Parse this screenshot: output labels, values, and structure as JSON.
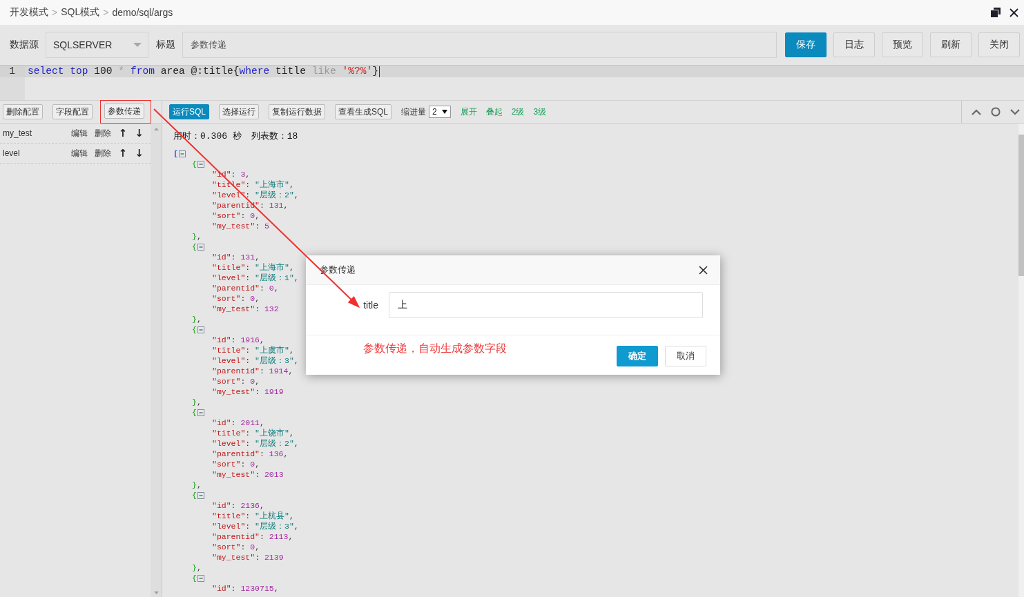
{
  "breadcrumb": [
    {
      "label": "开发模式",
      "separator": ">"
    },
    {
      "label": "SQL模式",
      "separator": ">"
    },
    {
      "label": "demo/sql/args"
    }
  ],
  "toolbar": {
    "datasource_label": "数据源",
    "datasource": "SQLSERVER",
    "title_label": "标题",
    "title_value": "参数传递",
    "buttons": [
      {
        "label": "保存",
        "kind": "primary"
      },
      {
        "label": "日志",
        "kind": "default"
      },
      {
        "label": "预览",
        "kind": "default"
      },
      {
        "label": "刷新",
        "kind": "default"
      },
      {
        "label": "关闭",
        "kind": "default"
      }
    ]
  },
  "editor": {
    "lines": [
      {
        "number": "1",
        "tokens": [
          {
            "kind": "keyword",
            "text": "select"
          },
          {
            "kind": "keyword",
            "text": " top"
          },
          {
            "kind": "number",
            "text": " 100"
          },
          {
            "kind": "operator",
            "text": " *"
          },
          {
            "kind": "keyword",
            "text": " from"
          },
          {
            "kind": "plain",
            "text": " area"
          },
          {
            "kind": "plain",
            "text": " @:title{"
          },
          {
            "kind": "keyword",
            "text": "where"
          },
          {
            "kind": "plain",
            "text": " title"
          },
          {
            "kind": "operator",
            "text": " like"
          },
          {
            "kind": "string",
            "text": " '%?%'"
          },
          {
            "kind": "plain",
            "text": "}"
          }
        ]
      }
    ]
  },
  "config_panel": {
    "buttons": [
      {
        "label": "删除配置",
        "highlighted": false
      },
      {
        "label": "字段配置",
        "highlighted": false
      },
      {
        "label": "参数传递",
        "highlighted": true
      }
    ],
    "fields": [
      {
        "name": "my_test",
        "edit": "编辑",
        "delete": "删除",
        "up": "↑",
        "down": "↓"
      },
      {
        "name": "level",
        "edit": "编辑",
        "delete": "删除",
        "up": "↑",
        "down": "↓"
      }
    ]
  },
  "result_toolbar": {
    "buttons": [
      {
        "label": "运行SQL",
        "kind": "primary"
      },
      {
        "label": "选择运行",
        "kind": "default"
      },
      {
        "label": "复制运行数据",
        "kind": "default"
      },
      {
        "label": "查看生成SQL",
        "kind": "default"
      }
    ],
    "indent_label": "缩进量",
    "indent_value": "2",
    "links": [
      "展开",
      "叠起",
      "2级",
      "3级"
    ]
  },
  "result": {
    "elapsed": "用时：0.306 秒",
    "count": "列表数：18",
    "open": "[",
    "expanded": true,
    "records": [
      {
        "open": "{",
        "expanded": true,
        "fields": [
          {
            "key": "\"id\"",
            "colon": ":",
            "value": "3",
            "kind": "number",
            "comma": ","
          },
          {
            "key": "\"title\"",
            "colon": ":",
            "value": "\"上海市\"",
            "kind": "string",
            "comma": ","
          },
          {
            "key": "\"level\"",
            "colon": ":",
            "value": "\"层级：2\"",
            "kind": "string",
            "comma": ","
          },
          {
            "key": "\"parentid\"",
            "colon": ":",
            "value": "131",
            "kind": "number",
            "comma": ","
          },
          {
            "key": "\"sort\"",
            "colon": ":",
            "value": "0",
            "kind": "number",
            "comma": ","
          },
          {
            "key": "\"my_test\"",
            "colon": ":",
            "value": "5",
            "kind": "number"
          }
        ],
        "close": "}",
        "comma": ","
      },
      {
        "open": "{",
        "expanded": true,
        "fields": [
          {
            "key": "\"id\"",
            "colon": ":",
            "value": "131",
            "kind": "number",
            "comma": ","
          },
          {
            "key": "\"title\"",
            "colon": ":",
            "value": "\"上海市\"",
            "kind": "string",
            "comma": ","
          },
          {
            "key": "\"level\"",
            "colon": ":",
            "value": "\"层级：1\"",
            "kind": "string",
            "comma": ","
          },
          {
            "key": "\"parentid\"",
            "colon": ":",
            "value": "0",
            "kind": "number",
            "comma": ","
          },
          {
            "key": "\"sort\"",
            "colon": ":",
            "value": "0",
            "kind": "number",
            "comma": ","
          },
          {
            "key": "\"my_test\"",
            "colon": ":",
            "value": "132",
            "kind": "number"
          }
        ],
        "close": "}",
        "comma": ","
      },
      {
        "open": "{",
        "expanded": true,
        "fields": [
          {
            "key": "\"id\"",
            "colon": ":",
            "value": "1916",
            "kind": "number",
            "comma": ","
          },
          {
            "key": "\"title\"",
            "colon": ":",
            "value": "\"上虞市\"",
            "kind": "string",
            "comma": ","
          },
          {
            "key": "\"level\"",
            "colon": ":",
            "value": "\"层级：3\"",
            "kind": "string",
            "comma": ","
          },
          {
            "key": "\"parentid\"",
            "colon": ":",
            "value": "1914",
            "kind": "number",
            "comma": ","
          },
          {
            "key": "\"sort\"",
            "colon": ":",
            "value": "0",
            "kind": "number",
            "comma": ","
          },
          {
            "key": "\"my_test\"",
            "colon": ":",
            "value": "1919",
            "kind": "number"
          }
        ],
        "close": "}",
        "comma": ","
      },
      {
        "open": "{",
        "expanded": true,
        "fields": [
          {
            "key": "\"id\"",
            "colon": ":",
            "value": "2011",
            "kind": "number",
            "comma": ","
          },
          {
            "key": "\"title\"",
            "colon": ":",
            "value": "\"上饶市\"",
            "kind": "string",
            "comma": ","
          },
          {
            "key": "\"level\"",
            "colon": ":",
            "value": "\"层级：2\"",
            "kind": "string",
            "comma": ","
          },
          {
            "key": "\"parentid\"",
            "colon": ":",
            "value": "136",
            "kind": "number",
            "comma": ","
          },
          {
            "key": "\"sort\"",
            "colon": ":",
            "value": "0",
            "kind": "number",
            "comma": ","
          },
          {
            "key": "\"my_test\"",
            "colon": ":",
            "value": "2013",
            "kind": "number"
          }
        ],
        "close": "}",
        "comma": ","
      },
      {
        "open": "{",
        "expanded": true,
        "fields": [
          {
            "key": "\"id\"",
            "colon": ":",
            "value": "2136",
            "kind": "number",
            "comma": ","
          },
          {
            "key": "\"title\"",
            "colon": ":",
            "value": "\"上杭县\"",
            "kind": "string",
            "comma": ","
          },
          {
            "key": "\"level\"",
            "colon": ":",
            "value": "\"层级：3\"",
            "kind": "string",
            "comma": ","
          },
          {
            "key": "\"parentid\"",
            "colon": ":",
            "value": "2113",
            "kind": "number",
            "comma": ","
          },
          {
            "key": "\"sort\"",
            "colon": ":",
            "value": "0",
            "kind": "number",
            "comma": ","
          },
          {
            "key": "\"my_test\"",
            "colon": ":",
            "value": "2139",
            "kind": "number"
          }
        ],
        "close": "}",
        "comma": ","
      },
      {
        "open": "{",
        "expanded": true,
        "fields": [
          {
            "key": "\"id\"",
            "colon": ":",
            "value": "1230715",
            "kind": "number",
            "comma": ","
          }
        ]
      }
    ]
  },
  "dialog": {
    "title": "参数传递",
    "params": [
      {
        "label": "title",
        "value": "上"
      }
    ],
    "note": "参数传递，自动生成参数字段",
    "buttons": [
      {
        "label": "确定",
        "kind": "primary"
      },
      {
        "label": "取消",
        "kind": "default"
      }
    ]
  }
}
